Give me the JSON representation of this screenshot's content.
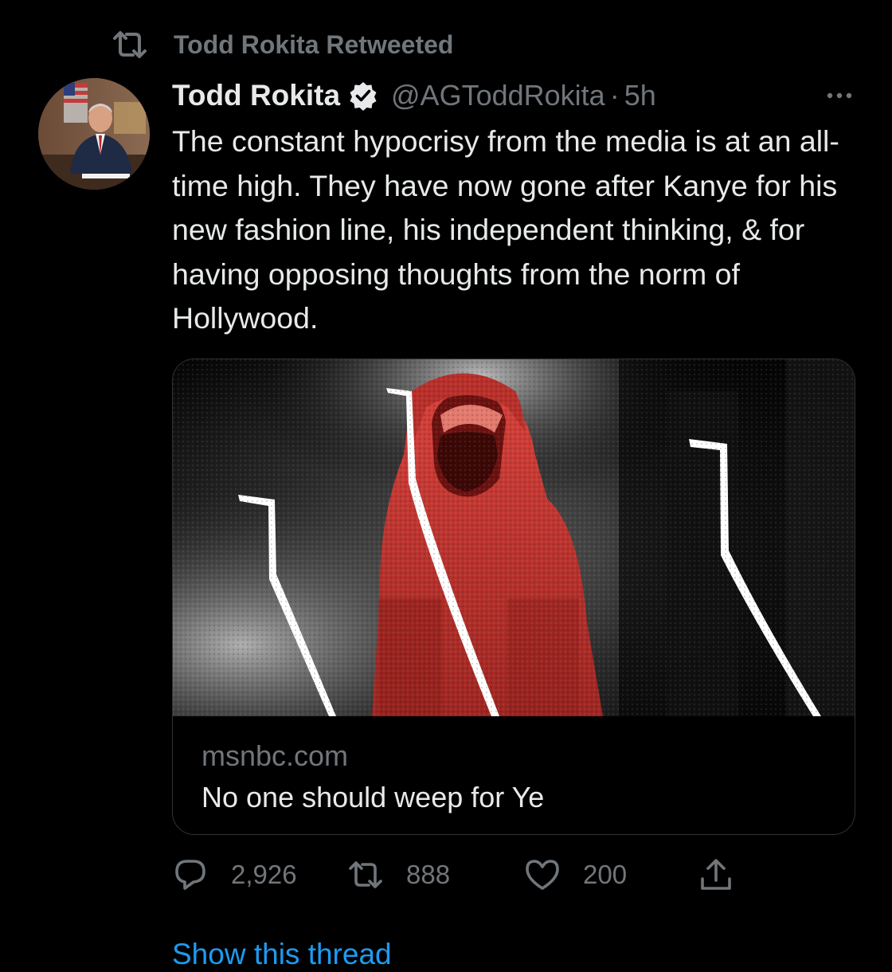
{
  "retweet_context": {
    "icon": "retweet-icon",
    "label": "Todd Rokita Retweeted"
  },
  "tweet": {
    "avatar": "avatar-photo",
    "display_name": "Todd Rokita",
    "verified_icon": "verified-badge-icon",
    "handle": "@AGToddRokita",
    "separator": "·",
    "time": "5h",
    "more_icon": "more-options-icon",
    "text": "The constant hypocrisy from the media is at an all-time high. They have now gone after Kanye for his new fashion line, his independent thinking, & for having opposing thoughts from the norm of Hollywood.",
    "card": {
      "image": "article-hero-image",
      "domain": "msnbc.com",
      "title": "No one should weep for Ye"
    },
    "actions": {
      "reply": {
        "icon": "reply-icon",
        "count": "2,926"
      },
      "retweet": {
        "icon": "retweet-icon",
        "count": "888"
      },
      "like": {
        "icon": "heart-icon",
        "count": "200"
      },
      "share": {
        "icon": "share-icon"
      }
    }
  },
  "show_thread": "Show this thread",
  "colors": {
    "background": "#000000",
    "text_primary": "#e7e9ea",
    "text_secondary": "#71767b",
    "link": "#1d9bf0",
    "card_accent": "#c8312c"
  }
}
